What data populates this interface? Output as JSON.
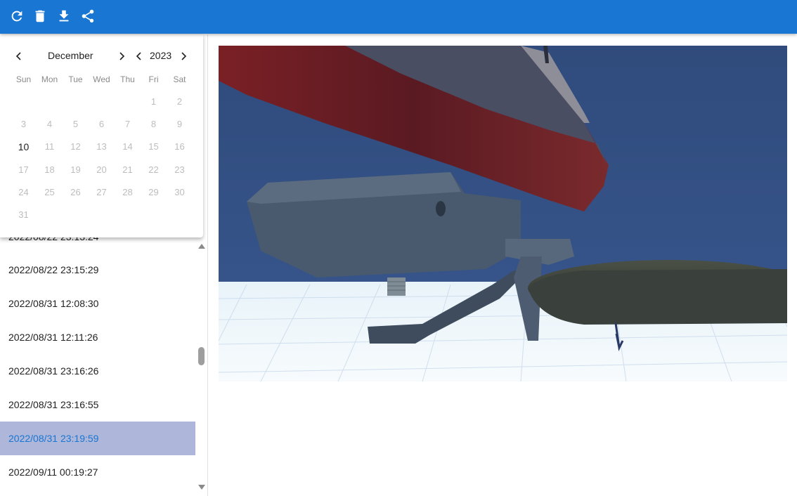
{
  "toolbar": {
    "buttons": [
      {
        "icon": "refresh-icon"
      },
      {
        "icon": "delete-icon"
      },
      {
        "icon": "download-icon"
      },
      {
        "icon": "share-icon"
      }
    ]
  },
  "calendar": {
    "month": "December",
    "year": "2023",
    "weekdays": [
      "Sun",
      "Mon",
      "Tue",
      "Wed",
      "Thu",
      "Fri",
      "Sat"
    ],
    "weeks": [
      [
        "",
        "",
        "",
        "",
        "",
        "1",
        "2"
      ],
      [
        "3",
        "4",
        "5",
        "6",
        "7",
        "8",
        "9"
      ],
      [
        "10",
        "11",
        "12",
        "13",
        "14",
        "15",
        "16"
      ],
      [
        "17",
        "18",
        "19",
        "20",
        "21",
        "22",
        "23"
      ],
      [
        "24",
        "25",
        "26",
        "27",
        "28",
        "29",
        "30"
      ],
      [
        "31",
        "",
        "",
        "",
        "",
        "",
        ""
      ]
    ],
    "enabled_day": "10"
  },
  "recordings": {
    "items": [
      "2022/08/22 23:15:29",
      "2022/08/31 12:08:30",
      "2022/08/31 12:11:26",
      "2022/08/31 23:16:26",
      "2022/08/31 23:16:55",
      "2022/08/31 23:19:59",
      "2022/09/11 00:19:27"
    ],
    "selected_index": 5,
    "scroll_position": 0.45
  },
  "colors": {
    "appbar": "#1976d2",
    "selected_row": "#aeb6d9",
    "selected_text": "#1976d2"
  }
}
